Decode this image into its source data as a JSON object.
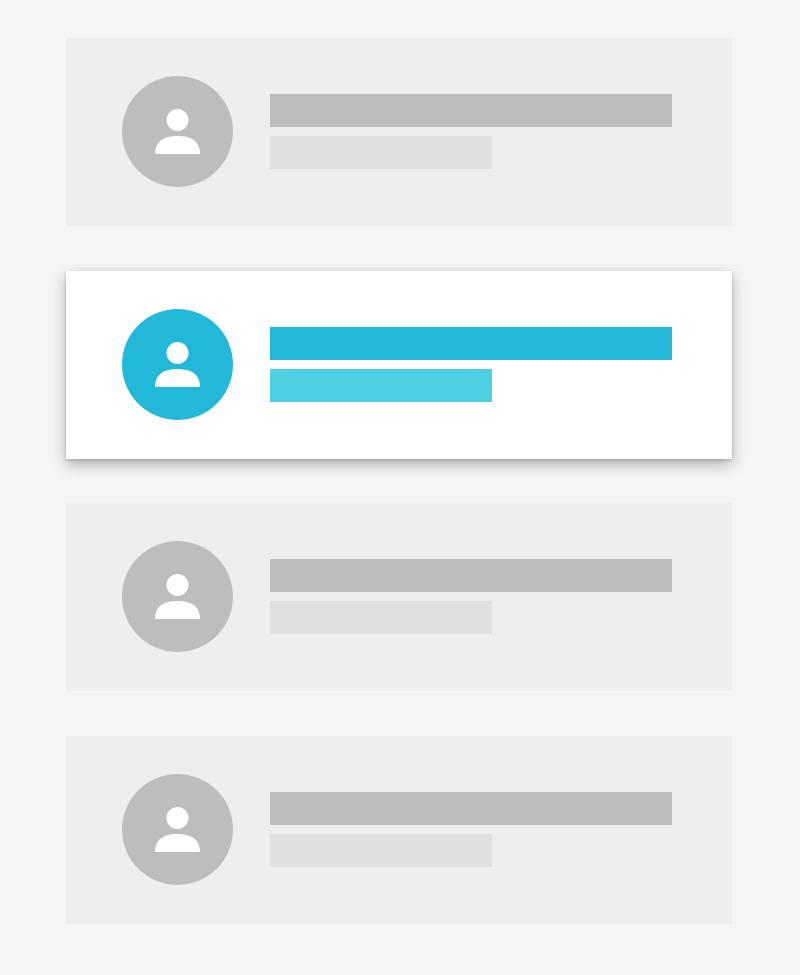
{
  "colors": {
    "page_background": "#f5f5f5",
    "card_background": "#eeeeee",
    "selected_card_background": "#ffffff",
    "placeholder_avatar": "#bdbdbd",
    "placeholder_primary_line": "#bdbdbd",
    "placeholder_secondary_line": "#e0e0e0",
    "accent": "#22b8d8",
    "accent_light": "#4fd0e2",
    "avatar_glyph": "#ffffff"
  },
  "list": {
    "items": [
      {
        "state": "default",
        "icon": "person-icon"
      },
      {
        "state": "selected",
        "icon": "person-icon"
      },
      {
        "state": "default",
        "icon": "person-icon"
      },
      {
        "state": "default",
        "icon": "person-icon"
      }
    ]
  }
}
